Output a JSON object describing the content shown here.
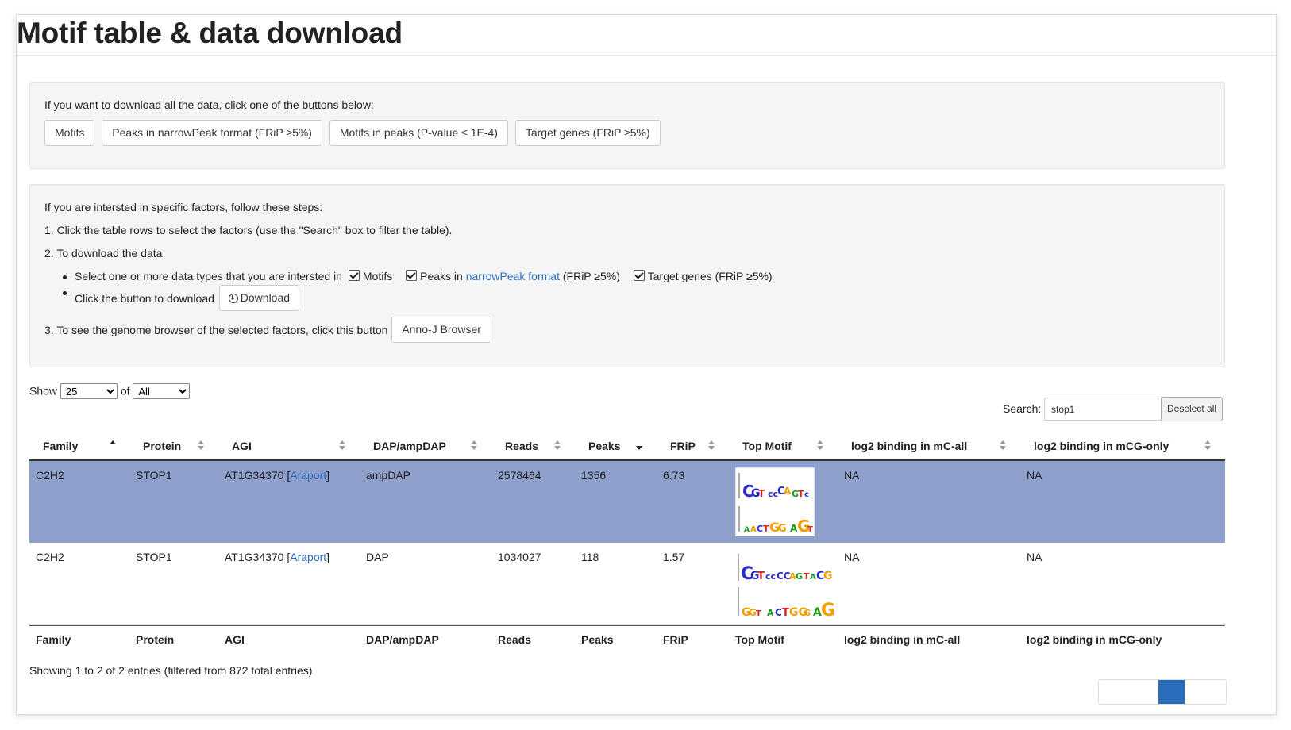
{
  "page_title": "Motif table & data download",
  "download_all": {
    "intro": "If you want to download all the data, click one of the buttons below:",
    "buttons": [
      "Motifs",
      "Peaks in narrowPeak format (FRiP ≥5%)",
      "Motifs in peaks (P-value ≤ 1E-4)",
      "Target genes (FRiP ≥5%)"
    ]
  },
  "specific": {
    "intro": "If you are intersted in specific factors, follow these steps:",
    "step1": "1. Click the table rows to select the factors (use the \"Search\" box to filter the table).",
    "step2": "2. To download the data",
    "bullet1_prefix": "Select one or more data types that you are intersted in",
    "cb_motifs": "Motifs",
    "cb_peaks_prefix": "Peaks in ",
    "cb_peaks_link": "narrowPeak format",
    "cb_peaks_suffix": " (FRiP ≥5%)",
    "cb_targets": "Target genes (FRiP ≥5%)",
    "bullet2_prefix": "Click the button to download",
    "download_button": "Download",
    "step3": "3. To see the genome browser of the selected factors, click this button",
    "browser_button": "Anno-J Browser"
  },
  "controls": {
    "show_label": "Show",
    "show_value": "25",
    "of_label": "of",
    "of_value": "All",
    "search_label": "Search:",
    "search_value": "stop1",
    "deselect_button": "Deselect all"
  },
  "table": {
    "columns": [
      "Family",
      "Protein",
      "AGI",
      "DAP/ampDAP",
      "Reads",
      "Peaks",
      "FRiP",
      "Top Motif",
      "log2 binding in mC-all",
      "log2 binding in mCG-only"
    ],
    "sort_state": [
      "asc",
      "both",
      "both",
      "both",
      "both",
      "desc",
      "both",
      "both",
      "both",
      "both"
    ],
    "rows": [
      {
        "family": "C2H2",
        "protein": "STOP1",
        "agi": "AT1G34370",
        "agi_link": "Araport",
        "dap": "ampDAP",
        "reads": "2578464",
        "peaks": "1356",
        "frip": "6.73",
        "mc_all": "NA",
        "mcg_only": "NA",
        "selected": true
      },
      {
        "family": "C2H2",
        "protein": "STOP1",
        "agi": "AT1G34370",
        "agi_link": "Araport",
        "dap": "DAP",
        "reads": "1034027",
        "peaks": "118",
        "frip": "1.57",
        "mc_all": "NA",
        "mcg_only": "NA",
        "selected": false
      }
    ]
  },
  "footer_info": "Showing 1 to 2 of 2 entries (filtered from 872 total entries)"
}
